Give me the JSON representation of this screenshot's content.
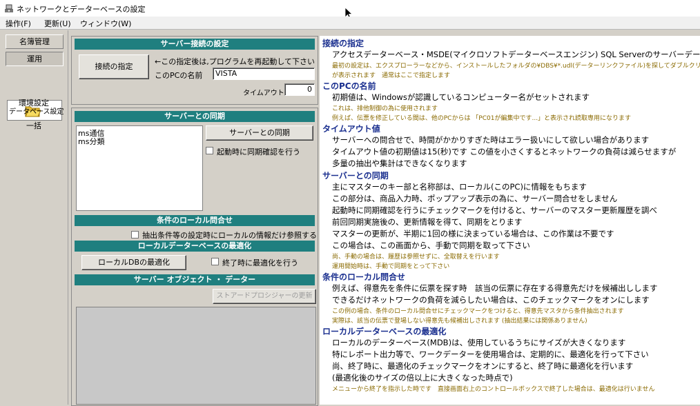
{
  "window": {
    "title": "ネットワークとデーターベースの設定"
  },
  "menu": {
    "items": [
      "操作(F)",
      "更新(U)",
      "ウィンドウ(W)"
    ]
  },
  "nav": {
    "tab_master": "名簿管理",
    "tab_ops": "運用",
    "db_settings": "データベース設定",
    "env_settings": "環境設定",
    "bulk": "一括"
  },
  "server_connection": {
    "header": "サーバー接続の設定",
    "connect_button": "接続の指定",
    "restart_note": "←この指定後は,プログラムを再起動して下さい",
    "pc_name_label": "このPCの名前",
    "pc_name_value": "VISTA",
    "timeout_label": "タイムアウト値",
    "timeout_value": "0"
  },
  "server_sync": {
    "header": "サーバーとの同期",
    "list_items": [
      "ms通信",
      "ms分類"
    ],
    "sync_button": "サーバーとの同期",
    "startup_check_label": "起動時に同期確認を行う"
  },
  "local_query": {
    "header": "条件のローカル問合せ",
    "check_label": "抽出条件等の設定時にローカルの情報だけ参照する"
  },
  "local_db": {
    "header": "ローカルデーターベースの最適化",
    "optimize_button": "ローカルDBの最適化",
    "exit_check_label": "終了時に最適化を行う"
  },
  "server_objects": {
    "header": "サーバー オブジェクト ・ データー",
    "stored_button": "ストアードプロシジャーの更新"
  },
  "help": {
    "sections": [
      {
        "title": "接続の指定",
        "lines": [
          {
            "t": "line",
            "text": "アクセスデーターベース・MSDE(マイクロソフトデーターベースエンジン) SQL Serverのサーバーデーターベースとの接続を指定し"
          },
          {
            "t": "note",
            "text": "最初の設定は、エクスプローラーなどから、インストールしたフォルダの¥DBS¥*.udl(データーリンクファイル)を探してダブルクリックすると、接続"
          },
          {
            "t": "note",
            "text": "が表示されます　通常はここで指定します"
          }
        ]
      },
      {
        "title": "このPCの名前",
        "lines": [
          {
            "t": "line",
            "text": "初期値は、Windowsが認識しているコンピューター名がセットされます"
          },
          {
            "t": "note",
            "text": "これは、排他制御の為に使用されます"
          },
          {
            "t": "note",
            "text": "例えば、伝票を修正している間は、他のPCからは 「PC01が編集中です...」と表示され読取専用になります"
          }
        ]
      },
      {
        "title": "タイムアウト値",
        "lines": [
          {
            "t": "line",
            "text": "サーバーへの問合せで、時間がかかりすぎた時はエラー扱いにして欲しい場合があります"
          },
          {
            "t": "line",
            "text": "タイムアウト値の初期値は15(秒)です この値を小さくするとネットワークの負荷は減らせますが"
          },
          {
            "t": "line",
            "text": "多量の抽出や集計はできなくなります"
          }
        ]
      },
      {
        "title": "サーバーとの同期",
        "lines": [
          {
            "t": "line",
            "text": "主にマスターのキー部と名称部は、ローカル(このPC)に情報をもちます"
          },
          {
            "t": "line",
            "text": "この部分は、商品入力時、ポップアップ表示の為に、サーバー問合せをしません"
          },
          {
            "t": "line",
            "text": "起動時に同期確認を行うにチェックマークを付けると、サーバーのマスター更新履歴を調べ"
          },
          {
            "t": "line",
            "text": "前回同期実施後の、更新情報を得て、同期をとります"
          },
          {
            "t": "line",
            "text": "マスターの更新が、半期に1回の様に決まっている場合は、この作業は不要です"
          },
          {
            "t": "line",
            "text": "この場合は、この画面から、手動で同期を取って下さい"
          },
          {
            "t": "note",
            "text": "尚、手動の場合は、履歴は参照せずに、全取替えを行います"
          },
          {
            "t": "note",
            "text": "運用開始時は、手動で同期をとって下さい"
          }
        ]
      },
      {
        "title": "条件のローカル問合せ",
        "lines": [
          {
            "t": "line",
            "text": "例えば、得意先を条件に伝票を探す時　該当の伝票に存在する得意先だけを候補出しします"
          },
          {
            "t": "line",
            "text": "できるだけネットワークの負荷を減らしたい場合は、このチェックマークをオンにします"
          },
          {
            "t": "note",
            "text": "この例の場合、条件のローカル問合せにチェックマークをつけると、得意先マスタから条件抽出されます"
          },
          {
            "t": "note",
            "text": "実際は、該当の伝票で登場しない得意先も候補出しされます (抽出結果には関係ありません)"
          }
        ]
      },
      {
        "title": "ローカルデーターベースの最適化",
        "lines": [
          {
            "t": "line",
            "text": "ローカルのデーターベース(MDB)は、使用しているうちにサイズが大きくなります"
          },
          {
            "t": "line",
            "text": "特にレポート出力等で、ワークデーターを使用場合は、定期的に、最適化を行って下さい"
          },
          {
            "t": "line",
            "text": "尚、終了時に、最適化のチェックマークをオンにすると、終了時に最適化を行います"
          },
          {
            "t": "line",
            "text": "(最適化後のサイズの倍以上に大きくなった時点で)"
          },
          {
            "t": "note",
            "text": "メニューから終了を指示した時です　直接画面右上のコントロールボックスで終了した場合は、最適化は行いません"
          }
        ]
      }
    ]
  }
}
